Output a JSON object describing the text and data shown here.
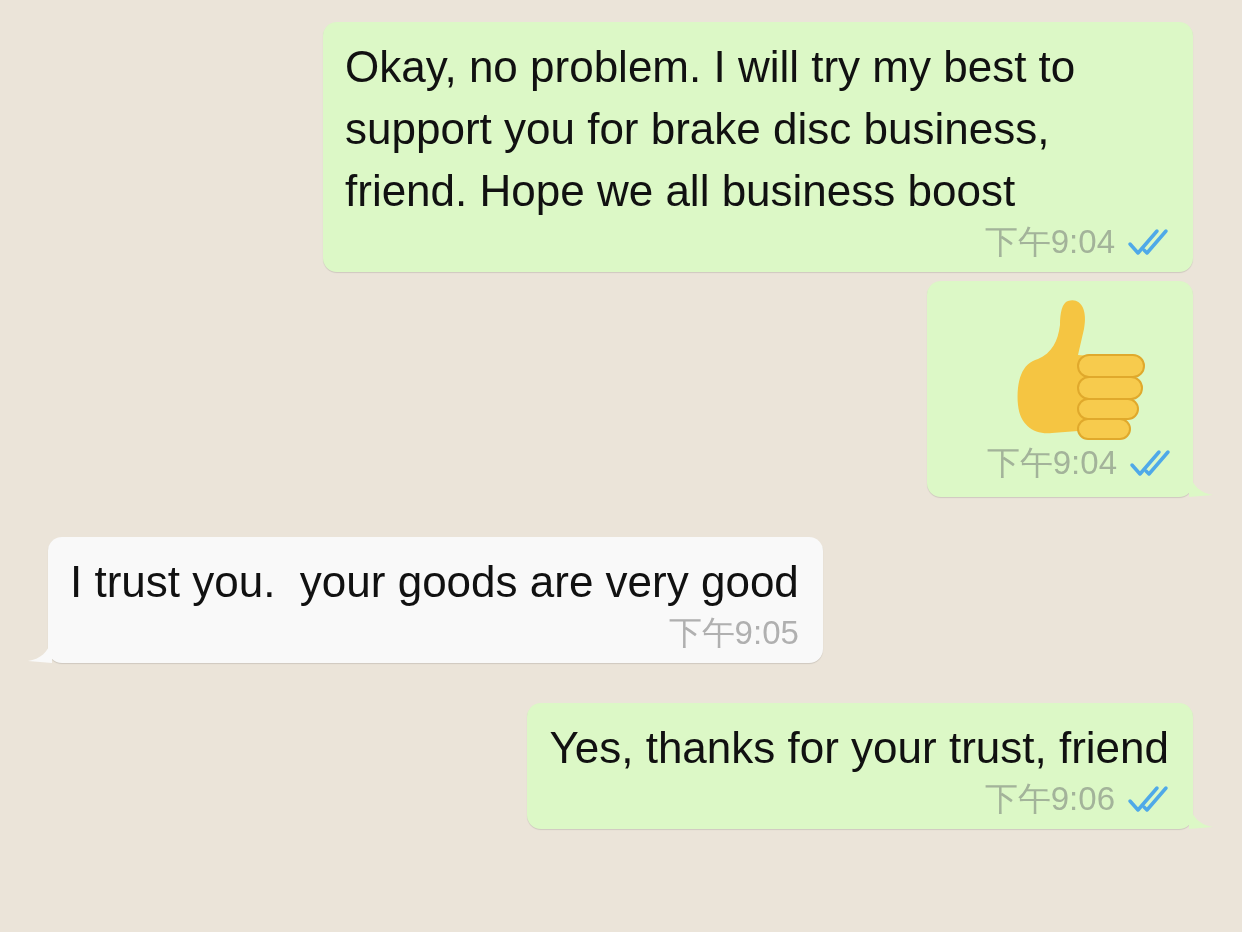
{
  "messages": [
    {
      "kind": "text",
      "outgoing": true,
      "tail": false,
      "text": "Okay, no problem. I will try my best to support you for brake disc business, friend. Hope we all business boost",
      "time": "下午9:04",
      "read": true
    },
    {
      "kind": "sticker",
      "outgoing": true,
      "tail": true,
      "time": "下午9:04",
      "read": true
    },
    {
      "kind": "text",
      "outgoing": false,
      "tail": true,
      "text": "I trust you.  your goods are very good",
      "time": "下午9:05"
    },
    {
      "kind": "text",
      "outgoing": true,
      "tail": true,
      "text": "Yes, thanks for your trust, friend",
      "time": "下午9:06",
      "read": true
    }
  ]
}
